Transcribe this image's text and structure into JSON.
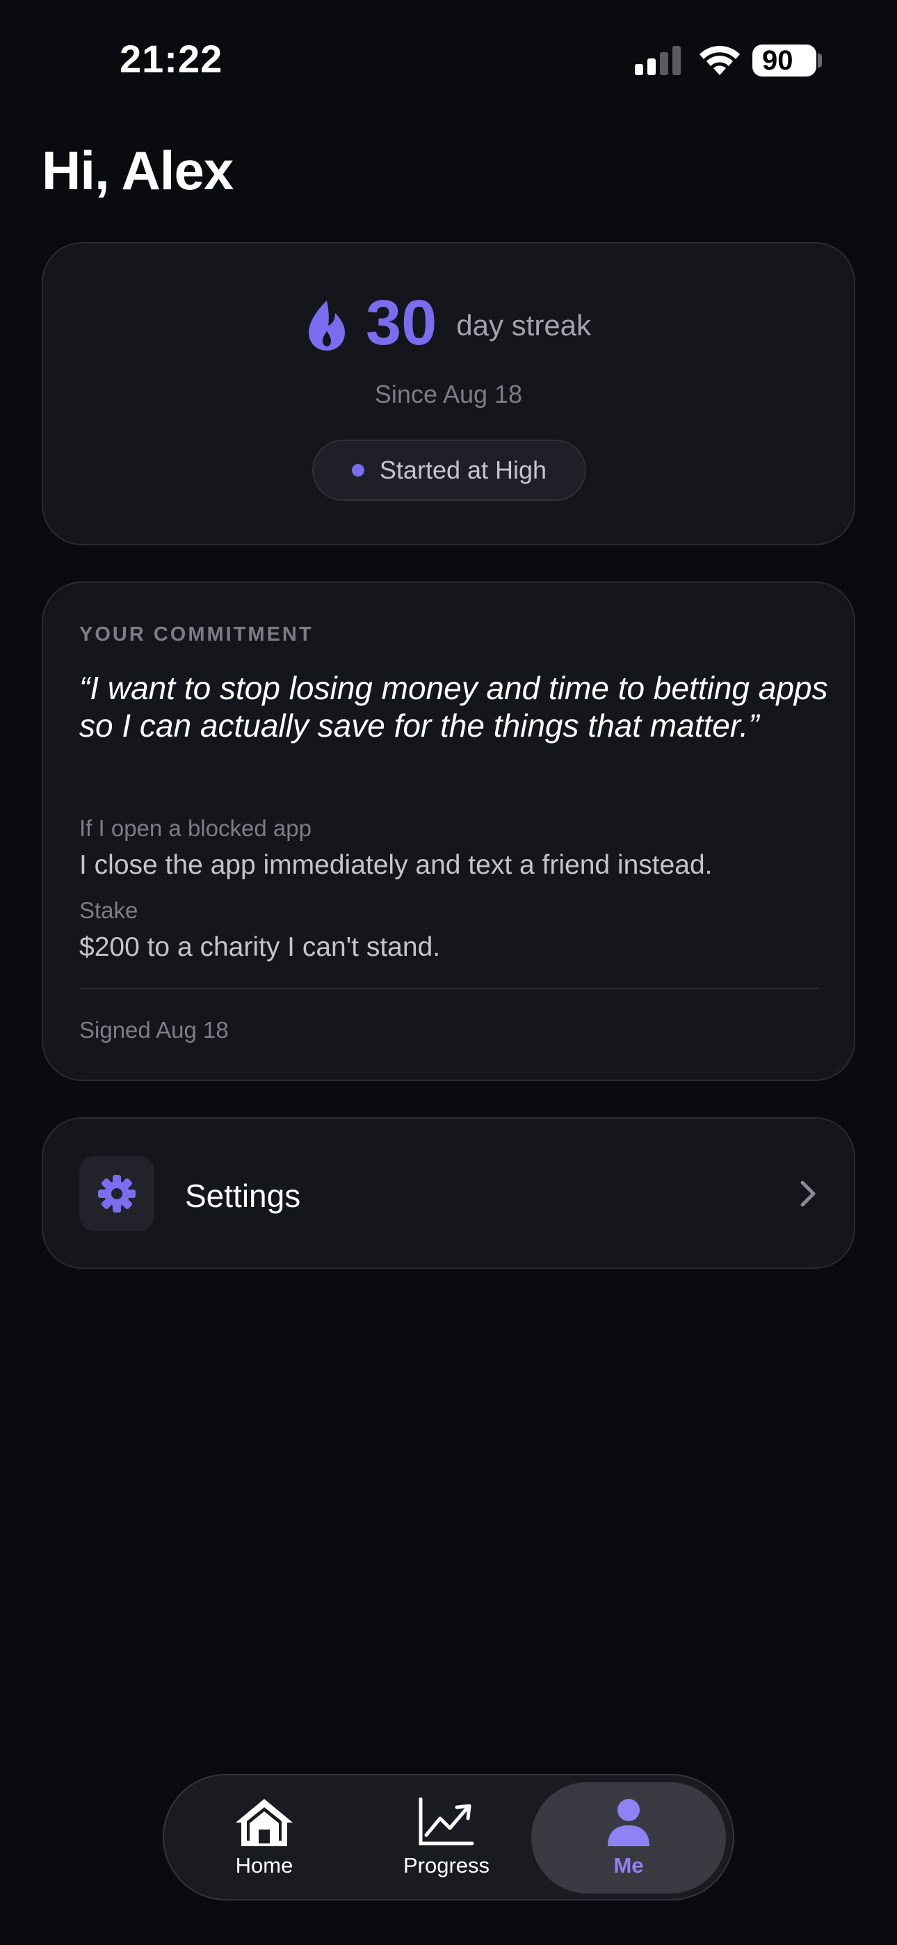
{
  "status_bar": {
    "time": "21:22",
    "battery": "90"
  },
  "greeting": "Hi, Alex",
  "streak": {
    "count": "30",
    "label": "day streak",
    "since": "Since Aug 18",
    "level_badge": "Started at High"
  },
  "commitment": {
    "heading": "YOUR COMMITMENT",
    "quote": "“I want to stop losing money and time to betting apps so I can actually save for the things that matter.”",
    "if_label": "If I open a blocked app",
    "if_value": "I close the app immediately and text a friend instead.",
    "stake_label": "Stake",
    "stake_value": "$200 to a charity I can't stand.",
    "signed": "Signed Aug 18"
  },
  "settings": {
    "label": "Settings",
    "icon": "gear-icon"
  },
  "tab_bar": {
    "tabs": [
      {
        "label": "Home",
        "icon": "home-icon"
      },
      {
        "label": "Progress",
        "icon": "chart-icon"
      },
      {
        "label": "Me",
        "icon": "person-icon"
      }
    ],
    "active": "Me"
  },
  "colors": {
    "accent": "#7b6cf0",
    "background": "#0a0b0e",
    "card": "#15161b"
  }
}
